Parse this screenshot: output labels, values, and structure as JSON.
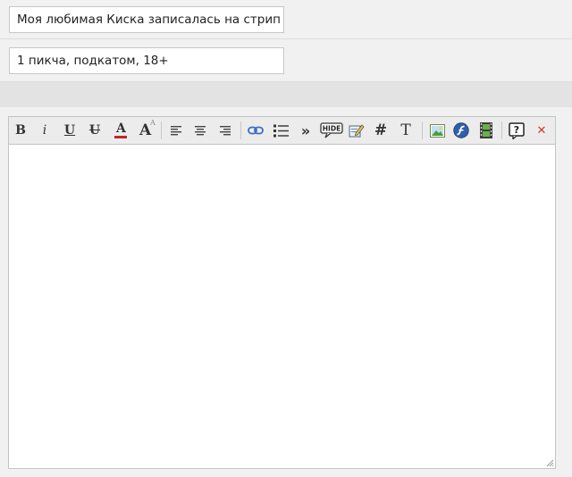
{
  "fields": {
    "title_value": "Моя любимая Киска записалась на стрип",
    "description_value": "1 пикча, подкатом, 18+"
  },
  "toolbar": {
    "bold": "B",
    "italic": "i",
    "underline": "U",
    "strike": "U",
    "font_color": "A",
    "font_size": "A",
    "hide": "HIDE",
    "hash": "#",
    "text": "T",
    "quote": "»",
    "help": "?",
    "close": "✕"
  },
  "colors": {
    "font_color_bar": "#c0262a",
    "close_red": "#d9342b",
    "link_blue": "#3a6fc4"
  }
}
